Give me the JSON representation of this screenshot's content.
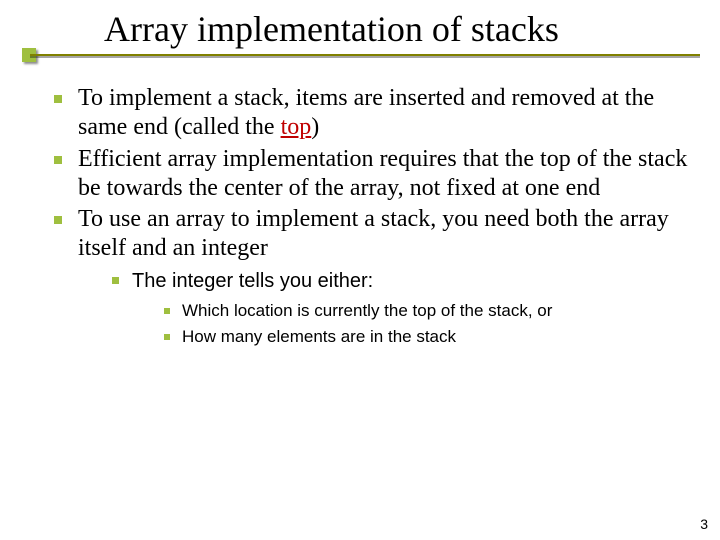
{
  "title": "Array implementation of stacks",
  "bullets": {
    "b1_pre": "To implement a stack, items are inserted and removed at the same end (called the ",
    "b1_term": "top",
    "b1_post": ")",
    "b2": "Efficient array implementation requires that the top of the stack be towards the center of the array, not fixed at one end",
    "b3": "To use an array to implement a stack, you need both the array itself and an integer",
    "b3_1": "The integer tells you either:",
    "b3_1_1": "Which location is currently the top of the stack, or",
    "b3_1_2": "How many elements are in the stack"
  },
  "page_number": "3"
}
